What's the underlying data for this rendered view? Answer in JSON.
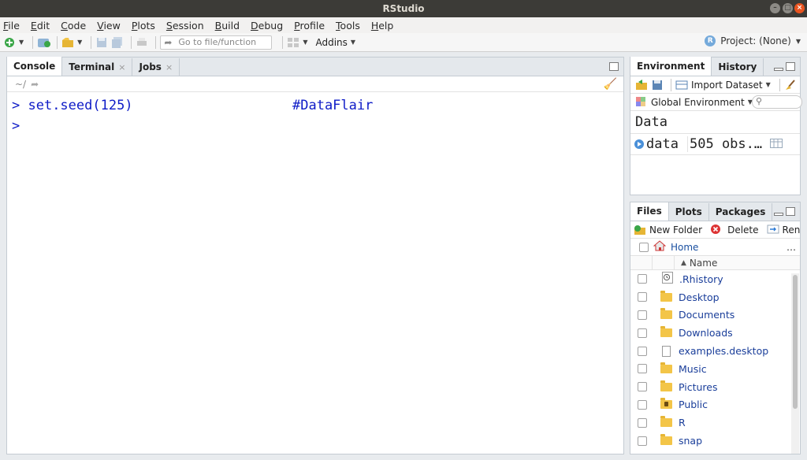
{
  "window": {
    "title": "RStudio"
  },
  "menu": [
    "File",
    "Edit",
    "Code",
    "View",
    "Plots",
    "Session",
    "Build",
    "Debug",
    "Profile",
    "Tools",
    "Help"
  ],
  "toolbar": {
    "goto_placeholder": "Go to file/function",
    "addins_label": "Addins",
    "project_label": "Project: (None)"
  },
  "console_pane": {
    "tabs": [
      {
        "label": "Console",
        "closable": false,
        "active": true
      },
      {
        "label": "Terminal",
        "closable": true,
        "active": false
      },
      {
        "label": "Jobs",
        "closable": true,
        "active": false
      }
    ],
    "path": "~/",
    "lines": [
      {
        "prompt": ">",
        "code": " set.seed(125)",
        "comment": "#DataFlair"
      },
      {
        "prompt": ">",
        "code": "",
        "comment": ""
      }
    ]
  },
  "environment_pane": {
    "tabs": [
      {
        "label": "Environment",
        "active": true
      },
      {
        "label": "History",
        "active": false
      }
    ],
    "import_label": "Import Dataset",
    "scope_label": "Global Environment",
    "section_title": "Data",
    "rows": [
      {
        "name": "data",
        "value": "505 obs.…"
      }
    ]
  },
  "files_pane": {
    "tabs": [
      {
        "label": "Files",
        "active": true
      },
      {
        "label": "Plots",
        "active": false
      },
      {
        "label": "Packages",
        "active": false
      }
    ],
    "new_folder_label": "New Folder",
    "delete_label": "Delete",
    "rename_label": "Rena",
    "breadcrumb_home": "Home",
    "column_name": "Name",
    "sort_indicator": "▲",
    "items": [
      {
        "name": ".Rhistory",
        "icon": "history-icon"
      },
      {
        "name": "Desktop",
        "icon": "folder-icon"
      },
      {
        "name": "Documents",
        "icon": "folder-icon"
      },
      {
        "name": "Downloads",
        "icon": "folder-icon"
      },
      {
        "name": "examples.desktop",
        "icon": "file-icon"
      },
      {
        "name": "Music",
        "icon": "folder-icon"
      },
      {
        "name": "Pictures",
        "icon": "folder-icon"
      },
      {
        "name": "Public",
        "icon": "locked-folder-icon"
      },
      {
        "name": "R",
        "icon": "folder-icon"
      },
      {
        "name": "snap",
        "icon": "folder-icon"
      }
    ]
  },
  "colors": {
    "console_text": "#0e1bc7",
    "link_blue": "#1a3e9a",
    "folder": "#f3c548",
    "title_bar": "#3c3b37",
    "close_button": "#e95420"
  }
}
